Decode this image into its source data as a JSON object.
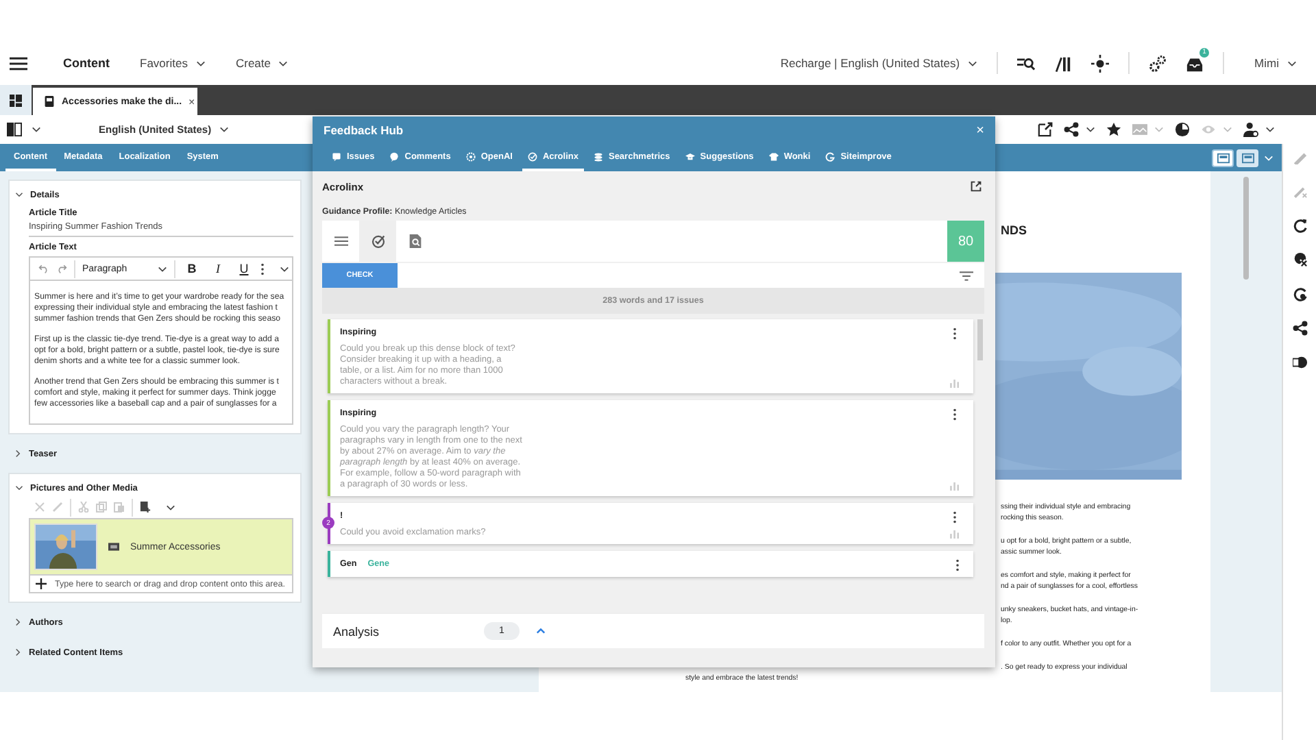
{
  "top_bar": {
    "section": "Content",
    "menus": [
      {
        "label": "Favorites"
      },
      {
        "label": "Create"
      }
    ],
    "site": "Recharge | English (United States)",
    "notifications": "1",
    "user": "Mimi"
  },
  "document_tab": {
    "title": "Accessories make the di...",
    "close": "×"
  },
  "toolbar": {
    "locale": "English (United States)"
  },
  "editor_tabs": [
    {
      "label": "Content",
      "selected": true
    },
    {
      "label": "Metadata",
      "selected": false
    },
    {
      "label": "Localization",
      "selected": false
    },
    {
      "label": "System",
      "selected": false
    }
  ],
  "view_modes": [
    {
      "selected": true
    },
    {
      "selected": false
    }
  ],
  "sections": [
    {
      "kind": "details",
      "title": "Details",
      "expanded": true,
      "article_title_label": "Article Title",
      "article_title": "Inspiring Summer Fashion Trends",
      "article_text_label": "Article Text",
      "block_style": "Paragraph",
      "format_buttons": [
        "B",
        "I",
        "U"
      ],
      "paragraphs": [
        [
          "Summer is here and it’s time to get your wardrobe ready for the sea",
          "expressing their individual style and embracing the latest fashion t",
          "summer fashion trends that Gen Zers should be rocking this seaso"
        ],
        [
          "First up is the classic tie-dye trend. Tie-dye is a great way to add a",
          "opt for a bold, bright pattern or a subtle, pastel look, tie-dye is sure",
          "denim shorts and a white tee for a classic summer look."
        ],
        [
          "Another trend that Gen Zers should be embracing this summer is t",
          "comfort and style, making it perfect for summer days. Think jogge",
          "few accessories like a baseball cap and a pair of sunglasses for a"
        ]
      ]
    },
    {
      "kind": "plain",
      "title": "Teaser",
      "expanded": false
    },
    {
      "kind": "media",
      "title": "Pictures and Other Media",
      "expanded": true,
      "items": [
        {
          "title": "Summer Accessories",
          "selected": true
        }
      ],
      "placeholder": "Type here to search or drag and drop content onto this area."
    },
    {
      "kind": "plain",
      "title": "Authors",
      "expanded": false
    },
    {
      "kind": "plain",
      "title": "Related Content Items",
      "expanded": false
    }
  ],
  "preview": {
    "heading": {
      "text": "NDS",
      "cut": true
    },
    "paragraphs": [
      [
        {
          "text": "ssing their individual style and embracing",
          "cut": true
        },
        {
          "text": "rocking this season.",
          "cut": true
        }
      ],
      [
        {
          "text": "u opt for a bold, bright pattern or a subtle,",
          "cut": true
        },
        {
          "text": "assic summer look.",
          "cut": true
        }
      ],
      [
        {
          "text": "es comfort and style, making it perfect for",
          "cut": true
        },
        {
          "text": "nd a pair of sunglasses for a cool, effortless",
          "cut": true
        }
      ],
      [
        {
          "text": "unky sneakers, bucket hats, and vintage-in-",
          "cut": true
        },
        {
          "text": "lop.",
          "cut": true
        }
      ],
      [
        {
          "text": "f color to any outfit. Whether you opt for a",
          "cut": true
        }
      ],
      [
        {
          "text": ". So get ready to express your individual",
          "cut": true
        },
        {
          "text": "style and embrace the latest trends!",
          "cut": false
        }
      ]
    ]
  },
  "feedback_hub": {
    "title": "Feedback Hub",
    "close": "×",
    "tabs": [
      {
        "label": "Issues",
        "selected": false
      },
      {
        "label": "Comments",
        "selected": false
      },
      {
        "label": "OpenAI",
        "selected": false
      },
      {
        "label": "Acrolinx",
        "selected": true
      },
      {
        "label": "Searchmetrics",
        "selected": false
      },
      {
        "label": "Suggestions",
        "selected": false
      },
      {
        "label": "Wonki",
        "selected": false
      },
      {
        "label": "Siteimprove",
        "selected": false
      }
    ],
    "panel_title": "Acrolinx",
    "guidance_profile": "**Guidance Profile:** Knowledge Articles",
    "tools": [
      {
        "selected": false
      },
      {
        "selected": true
      },
      {
        "selected": false
      }
    ],
    "score": "80",
    "check_button": "CHECK",
    "summary": "283 words and 17 issues",
    "issues": [
      {
        "title": "Inspiring",
        "text": "Could you break up this dense block of text? Consider breaking it up with a heading, a table, or a list. Aim for no more than 1000 characters without a break.",
        "color": "#9ccc55"
      },
      {
        "title": "Inspiring",
        "text": "Could you vary the paragraph length? Your paragraphs vary in length from one to the next by about 27% on average. Aim to *vary the paragraph length* by at least 40% on average. For example, follow a 50-word paragraph with a paragraph of 30 words or less.",
        "color": "#9ccc55"
      },
      {
        "title": "!",
        "text": "Could you avoid exclamation marks?",
        "color": "#9b3cc0",
        "badge": "2"
      },
      {
        "title": "Gen",
        "suggestion": "Gene",
        "color": "#3ab39c"
      }
    ],
    "analysis": {
      "label": "Analysis",
      "count": "1"
    }
  }
}
